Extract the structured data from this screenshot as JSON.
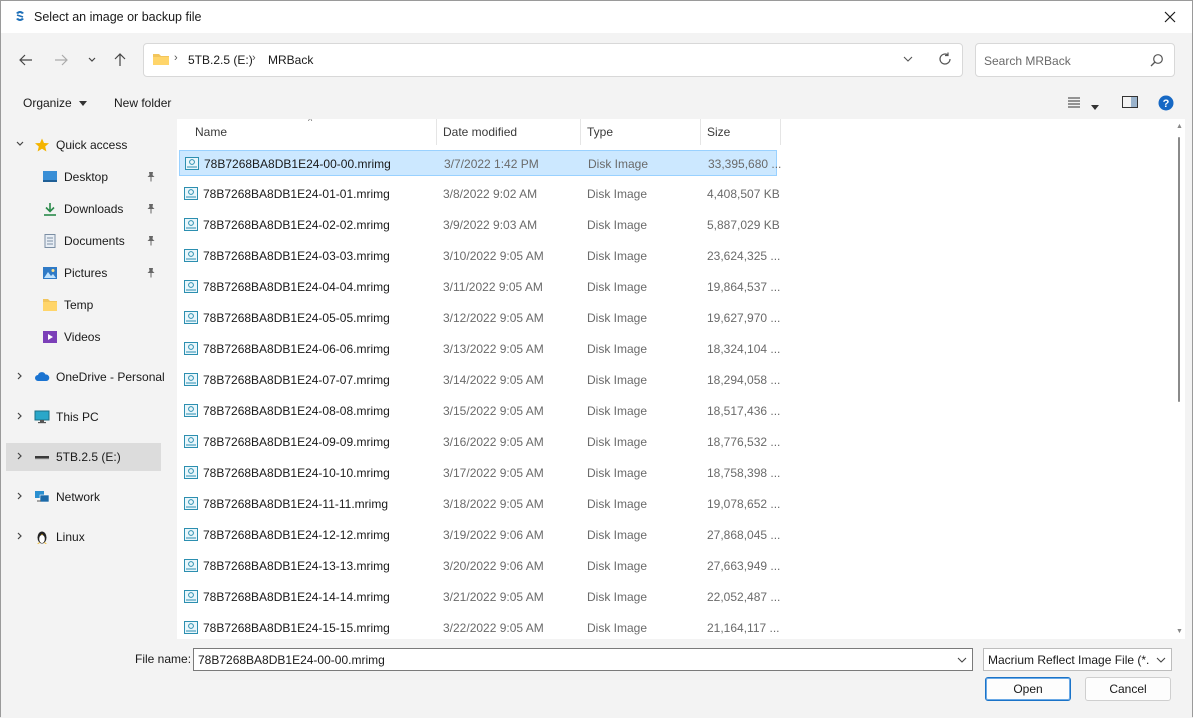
{
  "window": {
    "title": "Select an image or backup file"
  },
  "address": {
    "breadcrumbs": [
      "5TB.2.5 (E:)",
      "MRBack"
    ]
  },
  "search": {
    "placeholder": "Search MRBack"
  },
  "commandbar": {
    "organize": "Organize",
    "new_folder": "New folder"
  },
  "navpane": {
    "items": [
      {
        "label": "Quick access",
        "icon": "star-icon"
      },
      {
        "label": "Desktop",
        "icon": "desktop-icon"
      },
      {
        "label": "Downloads",
        "icon": "download-icon"
      },
      {
        "label": "Documents",
        "icon": "documents-icon"
      },
      {
        "label": "Pictures",
        "icon": "pictures-icon"
      },
      {
        "label": "Temp",
        "icon": "folder-icon"
      },
      {
        "label": "Videos",
        "icon": "videos-icon"
      },
      {
        "label": "OneDrive - Personal",
        "icon": "cloud-icon"
      },
      {
        "label": "This PC",
        "icon": "monitor-icon"
      },
      {
        "label": "5TB.2.5 (E:)",
        "icon": "drive-icon",
        "selected": true
      },
      {
        "label": "Network",
        "icon": "network-icon"
      },
      {
        "label": "Linux",
        "icon": "linux-penguin-icon"
      }
    ]
  },
  "columns": {
    "name": "Name",
    "date": "Date modified",
    "type": "Type",
    "size": "Size"
  },
  "files": [
    {
      "name": "78B7268BA8DB1E24-00-00.mrimg",
      "date": "3/7/2022 1:42 PM",
      "type": "Disk Image",
      "size": "33,395,680 ..."
    },
    {
      "name": "78B7268BA8DB1E24-01-01.mrimg",
      "date": "3/8/2022 9:02 AM",
      "type": "Disk Image",
      "size": "4,408,507 KB"
    },
    {
      "name": "78B7268BA8DB1E24-02-02.mrimg",
      "date": "3/9/2022 9:03 AM",
      "type": "Disk Image",
      "size": "5,887,029 KB"
    },
    {
      "name": "78B7268BA8DB1E24-03-03.mrimg",
      "date": "3/10/2022 9:05 AM",
      "type": "Disk Image",
      "size": "23,624,325 ..."
    },
    {
      "name": "78B7268BA8DB1E24-04-04.mrimg",
      "date": "3/11/2022 9:05 AM",
      "type": "Disk Image",
      "size": "19,864,537 ..."
    },
    {
      "name": "78B7268BA8DB1E24-05-05.mrimg",
      "date": "3/12/2022 9:05 AM",
      "type": "Disk Image",
      "size": "19,627,970 ..."
    },
    {
      "name": "78B7268BA8DB1E24-06-06.mrimg",
      "date": "3/13/2022 9:05 AM",
      "type": "Disk Image",
      "size": "18,324,104 ..."
    },
    {
      "name": "78B7268BA8DB1E24-07-07.mrimg",
      "date": "3/14/2022 9:05 AM",
      "type": "Disk Image",
      "size": "18,294,058 ..."
    },
    {
      "name": "78B7268BA8DB1E24-08-08.mrimg",
      "date": "3/15/2022 9:05 AM",
      "type": "Disk Image",
      "size": "18,517,436 ..."
    },
    {
      "name": "78B7268BA8DB1E24-09-09.mrimg",
      "date": "3/16/2022 9:05 AM",
      "type": "Disk Image",
      "size": "18,776,532 ..."
    },
    {
      "name": "78B7268BA8DB1E24-10-10.mrimg",
      "date": "3/17/2022 9:05 AM",
      "type": "Disk Image",
      "size": "18,758,398 ..."
    },
    {
      "name": "78B7268BA8DB1E24-11-11.mrimg",
      "date": "3/18/2022 9:05 AM",
      "type": "Disk Image",
      "size": "19,078,652 ..."
    },
    {
      "name": "78B7268BA8DB1E24-12-12.mrimg",
      "date": "3/19/2022 9:06 AM",
      "type": "Disk Image",
      "size": "27,868,045 ..."
    },
    {
      "name": "78B7268BA8DB1E24-13-13.mrimg",
      "date": "3/20/2022 9:06 AM",
      "type": "Disk Image",
      "size": "27,663,949 ..."
    },
    {
      "name": "78B7268BA8DB1E24-14-14.mrimg",
      "date": "3/21/2022 9:05 AM",
      "type": "Disk Image",
      "size": "22,052,487 ..."
    },
    {
      "name": "78B7268BA8DB1E24-15-15.mrimg",
      "date": "3/22/2022 9:05 AM",
      "type": "Disk Image",
      "size": "21,164,117 ..."
    }
  ],
  "bottom": {
    "file_name_label": "File name:",
    "file_name_value": "78B7268BA8DB1E24-00-00.mrimg",
    "filter": "Macrium Reflect Image File (*.mrimg)",
    "open": "Open",
    "cancel": "Cancel"
  },
  "colors": {
    "selection_bg": "#cce8ff",
    "selection_border": "#99d1ff",
    "accent": "#0067c0"
  }
}
